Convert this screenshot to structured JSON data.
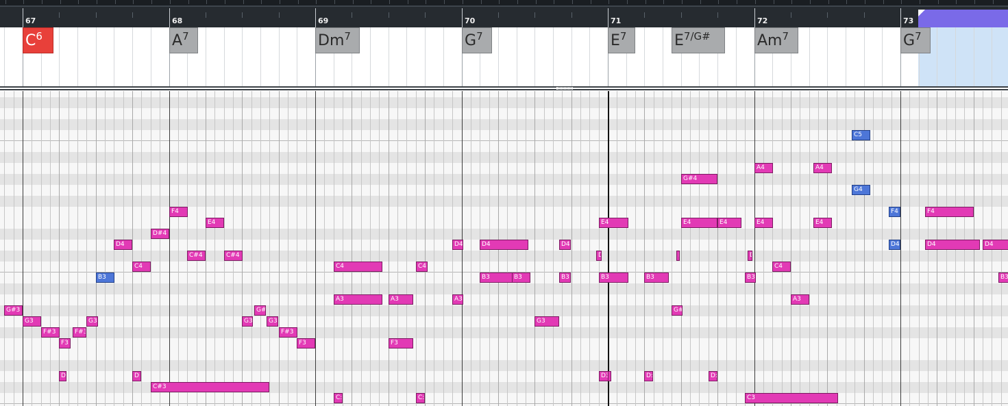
{
  "ruler": {
    "bars": [
      {
        "label": "67"
      },
      {
        "label": "68"
      },
      {
        "label": "69"
      },
      {
        "label": "70"
      },
      {
        "label": "71"
      },
      {
        "label": "72"
      },
      {
        "label": "73"
      }
    ]
  },
  "chords": [
    {
      "root": "C",
      "ext": "6",
      "active": true
    },
    {
      "root": "A",
      "ext": "7",
      "active": false
    },
    {
      "root": "Dm",
      "ext": "7",
      "active": false
    },
    {
      "root": "G",
      "ext": "7",
      "active": false
    },
    {
      "root": "E",
      "ext": "7",
      "active": false
    },
    {
      "root": "E",
      "ext": "7/G#",
      "active": false
    },
    {
      "root": "Am",
      "ext": "7",
      "active": false
    },
    {
      "root": "G",
      "ext": "7",
      "active": false
    }
  ],
  "notes": [
    {
      "label": "",
      "color": "pink"
    },
    {
      "label": "G#3",
      "color": "pink"
    },
    {
      "label": "G3",
      "color": "pink"
    },
    {
      "label": "F#3",
      "color": "pink"
    },
    {
      "label": "F3",
      "color": "pink"
    },
    {
      "label": "F#3",
      "color": "pink"
    },
    {
      "label": "G3",
      "color": "pink"
    },
    {
      "label": "B3",
      "color": "blue"
    },
    {
      "label": "D4",
      "color": "pink"
    },
    {
      "label": "C4",
      "color": "pink"
    },
    {
      "label": "D",
      "color": "pink"
    },
    {
      "label": "D",
      "color": "pink"
    },
    {
      "label": "D#4",
      "color": "pink"
    },
    {
      "label": "F4",
      "color": "pink"
    },
    {
      "label": "C#4",
      "color": "pink"
    },
    {
      "label": "E4",
      "color": "pink"
    },
    {
      "label": "C#4",
      "color": "pink"
    },
    {
      "label": "C#3",
      "color": "pink"
    },
    {
      "label": "G3",
      "color": "pink"
    },
    {
      "label": "G#",
      "color": "pink"
    },
    {
      "label": "G3",
      "color": "pink"
    },
    {
      "label": "F#3",
      "color": "pink"
    },
    {
      "label": "F3",
      "color": "pink"
    },
    {
      "label": "C4",
      "color": "pink"
    },
    {
      "label": "A3",
      "color": "pink"
    },
    {
      "label": "C:",
      "color": "pink"
    },
    {
      "label": "A3",
      "color": "pink"
    },
    {
      "label": "F3",
      "color": "pink"
    },
    {
      "label": "C4",
      "color": "pink"
    },
    {
      "label": "C:",
      "color": "pink"
    },
    {
      "label": "D4",
      "color": "pink"
    },
    {
      "label": "A3",
      "color": "pink"
    },
    {
      "label": "",
      "color": "pink"
    },
    {
      "label": "D4",
      "color": "pink"
    },
    {
      "label": "B3",
      "color": "pink"
    },
    {
      "label": "B3",
      "color": "pink"
    },
    {
      "label": "",
      "color": "pink"
    },
    {
      "label": "G3",
      "color": "pink"
    },
    {
      "label": "D4",
      "color": "pink"
    },
    {
      "label": "B3",
      "color": "pink"
    },
    {
      "label": "",
      "color": "pink"
    },
    {
      "label": "D",
      "color": "pink"
    },
    {
      "label": "E4",
      "color": "pink"
    },
    {
      "label": "B3",
      "color": "pink"
    },
    {
      "label": "D3",
      "color": "pink"
    },
    {
      "label": "",
      "color": "pink"
    },
    {
      "label": "B3",
      "color": "pink"
    },
    {
      "label": "D:",
      "color": "pink"
    },
    {
      "label": "G#",
      "color": "pink"
    },
    {
      "label": "D",
      "color": "pink"
    },
    {
      "label": "G#4",
      "color": "pink"
    },
    {
      "label": "E4",
      "color": "pink"
    },
    {
      "label": "E4",
      "color": "pink"
    },
    {
      "label": "D:",
      "color": "pink"
    },
    {
      "label": "B3",
      "color": "pink"
    },
    {
      "label": "C3",
      "color": "pink"
    },
    {
      "label": "D",
      "color": "pink"
    },
    {
      "label": "A4",
      "color": "pink"
    },
    {
      "label": "E4",
      "color": "pink"
    },
    {
      "label": "C4",
      "color": "pink"
    },
    {
      "label": "A3",
      "color": "pink"
    },
    {
      "label": "A4",
      "color": "pink"
    },
    {
      "label": "E4",
      "color": "pink"
    },
    {
      "label": "C5",
      "color": "blue"
    },
    {
      "label": "G4",
      "color": "blue"
    },
    {
      "label": "F4",
      "color": "blue"
    },
    {
      "label": "D4",
      "color": "blue"
    },
    {
      "label": "F4",
      "color": "pink"
    },
    {
      "label": "D4",
      "color": "pink"
    },
    {
      "label": "D4",
      "color": "pink"
    },
    {
      "label": "",
      "color": "pink"
    },
    {
      "label": "B3",
      "color": "pink"
    }
  ]
}
